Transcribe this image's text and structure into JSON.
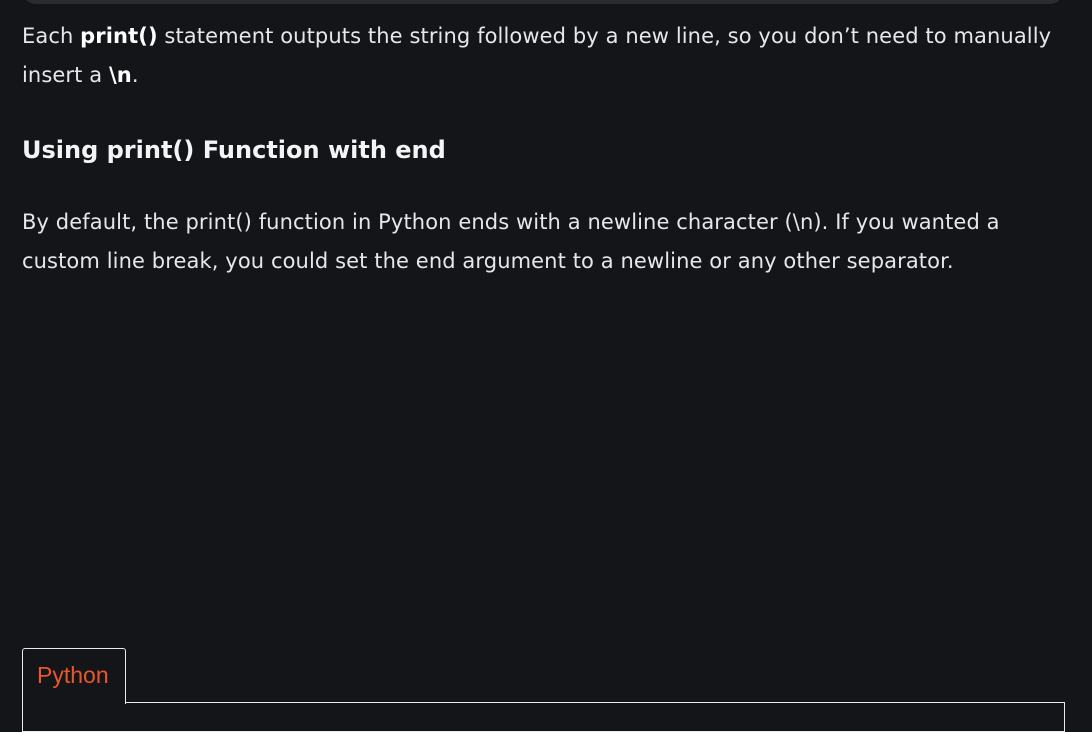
{
  "para1": {
    "t1": "Each ",
    "b1": "print()",
    "t2": " statement outputs the string followed by a new line, so you don’t need to manually insert a ",
    "b2": "\\n",
    "t3": "."
  },
  "heading": "Using print() Function with end",
  "para2": "By default, the print() function in Python ends with a newline character (\\n). If you wanted a custom line break, you could set the end argument to a newline or any other separator.",
  "code_tab": {
    "label": "Python",
    "color": "#e8572d"
  }
}
